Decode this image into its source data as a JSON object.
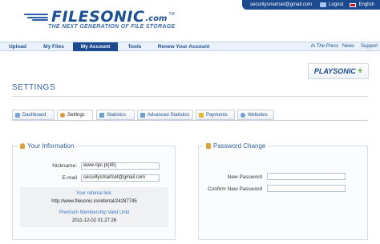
{
  "header": {
    "logo_text": "FILESONIC",
    "logo_suffix": ".com",
    "logo_tm": "TM",
    "tagline": "THE NEXT GENERATION OF FILE STORAGE",
    "user_email": "securitysmartset@gmail.com",
    "logout_label": "Logout",
    "language_label": "English"
  },
  "nav": {
    "items": [
      {
        "label": "Upload"
      },
      {
        "label": "My Files"
      },
      {
        "label": "My Account"
      },
      {
        "label": "Tools"
      },
      {
        "label": "Renew Your Account"
      }
    ],
    "right_items": [
      {
        "label": "In The Press"
      },
      {
        "label": "News"
      },
      {
        "label": "Support"
      }
    ],
    "active_index": 2
  },
  "playsonic": {
    "play": "PLAY",
    "sonic": "SONIC",
    "plus": "+"
  },
  "page_title": "SETTINGS",
  "tabs": [
    {
      "label": "Dashboard",
      "icon": "dashboard-icon",
      "color": "#7aa6d6"
    },
    {
      "label": "Settings",
      "icon": "settings-icon",
      "color": "#d99a3a"
    },
    {
      "label": "Statistics",
      "icon": "statistics-icon",
      "color": "#6f9ed1"
    },
    {
      "label": "Advanced Statistics",
      "icon": "advanced-statistics-icon",
      "color": "#6f9ed1"
    },
    {
      "label": "Payments",
      "icon": "payments-icon",
      "color": "#e2b43a"
    },
    {
      "label": "Websites",
      "icon": "websites-icon",
      "color": "#6f9ed1"
    }
  ],
  "info_panel": {
    "title": "Your Information",
    "nickname_label": "Nickname:",
    "nickname_value": "www.ripc.pl(45)",
    "email_label": "E-mail",
    "email_value": "securitysmartset@gmail.com",
    "referral_label": "Your referral link:",
    "referral_link": "http://www.filesonic.in/referral/24287745",
    "premium_label": "Premium Membership Valid Until",
    "premium_date": "2011-12-02 01:27:26"
  },
  "password_panel": {
    "title": "Password Change",
    "new_password_label": "New Password",
    "confirm_password_label": "Confirm New Password",
    "new_password_value": "",
    "confirm_password_value": ""
  },
  "colors": {
    "brand_blue": "#1c4a8e",
    "nav_bg": "#e9f1fa",
    "link_blue": "#3a78c8",
    "accent_green": "#4caf2a"
  }
}
